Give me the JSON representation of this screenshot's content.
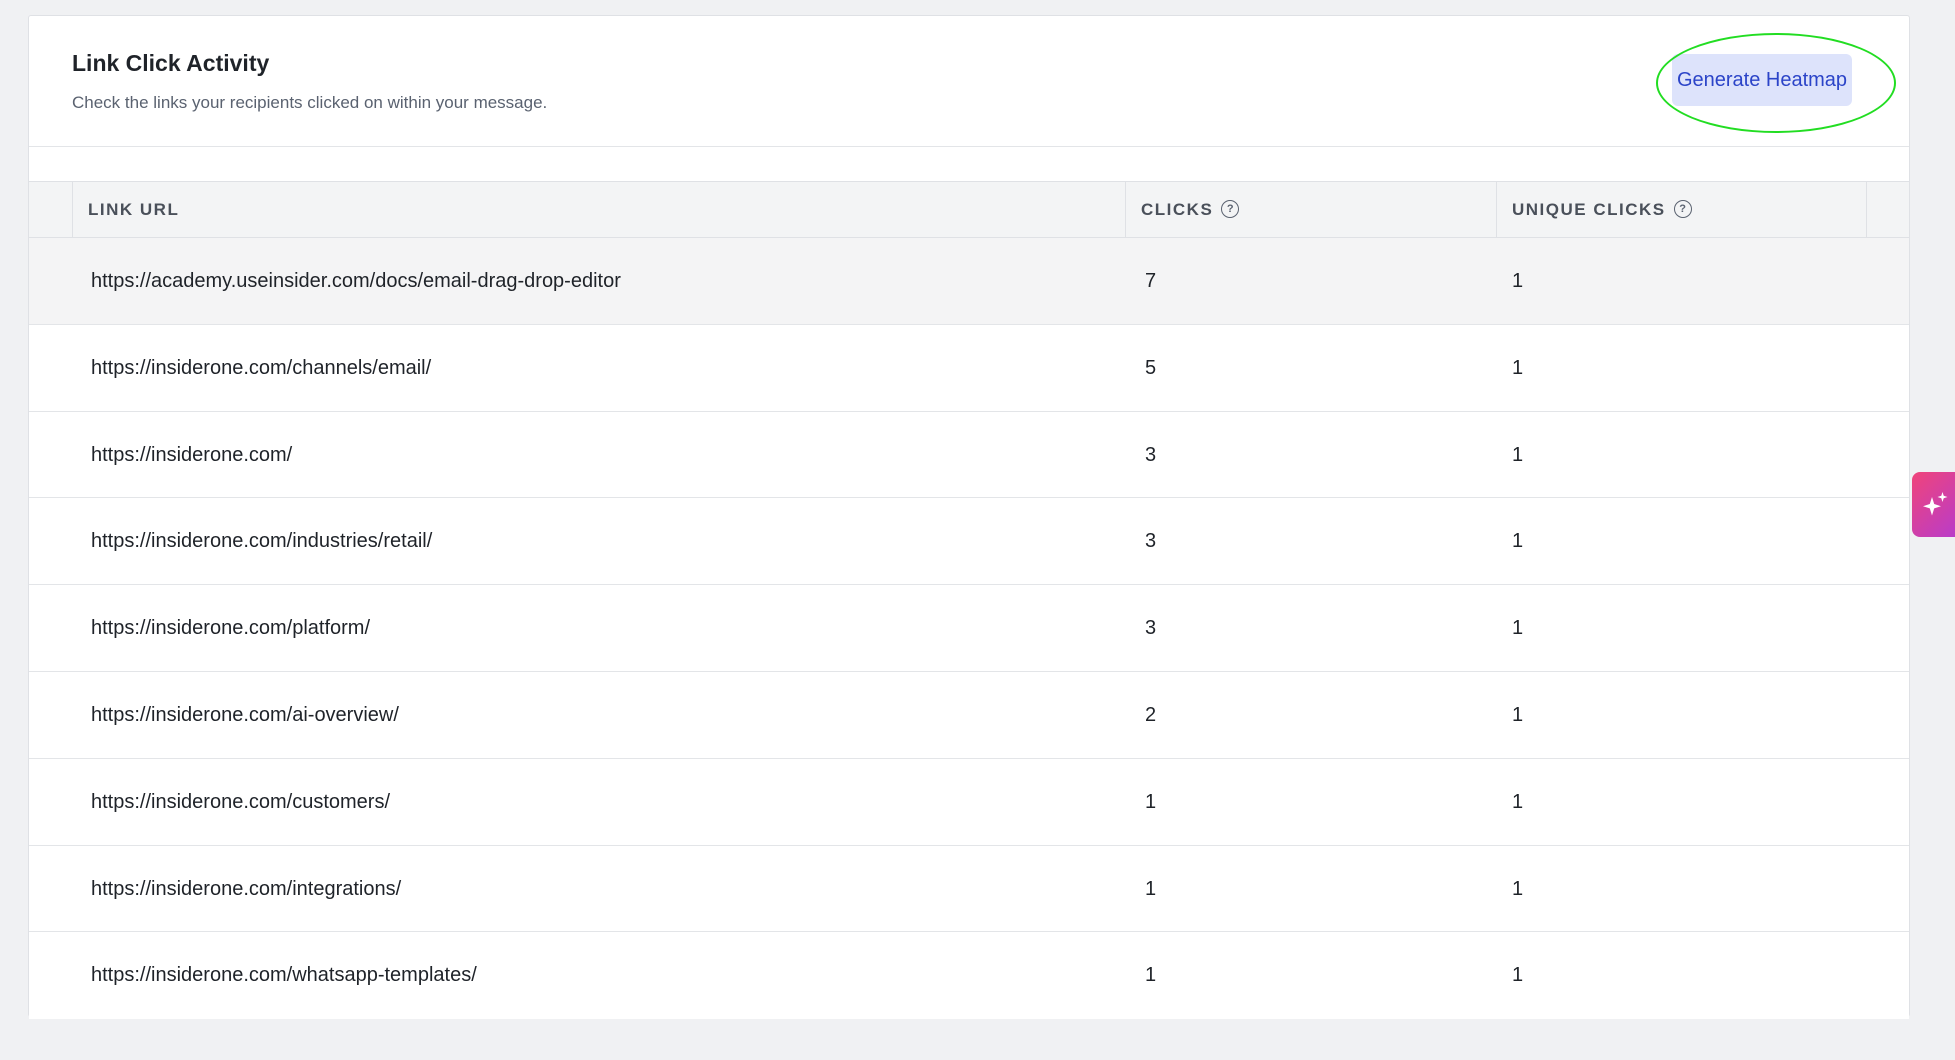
{
  "header": {
    "title": "Link Click Activity",
    "subtitle": "Check the links your recipients clicked on within your message.",
    "generate_button_label": "Generate Heatmap"
  },
  "table": {
    "columns": {
      "url": "LINK URL",
      "clicks": "CLICKS",
      "unique_clicks": "UNIQUE CLICKS"
    },
    "rows": [
      {
        "url": "https://academy.useinsider.com/docs/email-drag-drop-editor",
        "clicks": "7",
        "unique": "1"
      },
      {
        "url": "https://insiderone.com/channels/email/",
        "clicks": "5",
        "unique": "1"
      },
      {
        "url": "https://insiderone.com/",
        "clicks": "3",
        "unique": "1"
      },
      {
        "url": "https://insiderone.com/industries/retail/",
        "clicks": "3",
        "unique": "1"
      },
      {
        "url": "https://insiderone.com/platform/",
        "clicks": "3",
        "unique": "1"
      },
      {
        "url": "https://insiderone.com/ai-overview/",
        "clicks": "2",
        "unique": "1"
      },
      {
        "url": "https://insiderone.com/customers/",
        "clicks": "1",
        "unique": "1"
      },
      {
        "url": "https://insiderone.com/integrations/",
        "clicks": "1",
        "unique": "1"
      },
      {
        "url": "https://insiderone.com/whatsapp-templates/",
        "clicks": "1",
        "unique": "1"
      }
    ]
  },
  "icons": {
    "help": "help-circle-icon",
    "ai": "sparkle-icon"
  },
  "colors": {
    "accent": "#2b44c8",
    "button_bg": "#dde3fb",
    "highlight": "#22dd22",
    "ai_gradient_start": "#f0447a",
    "ai_gradient_end": "#b93cc9"
  }
}
